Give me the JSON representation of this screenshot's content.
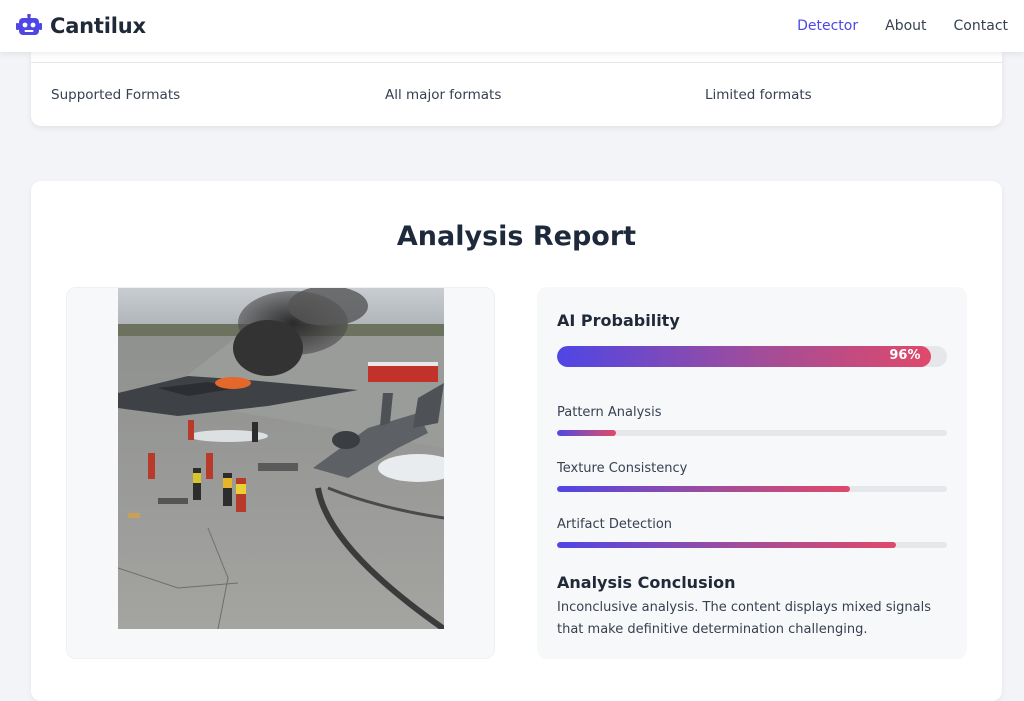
{
  "header": {
    "brand": "Cantilux",
    "brand_icon": "robot-icon",
    "nav": [
      {
        "label": "Detector",
        "active": true
      },
      {
        "label": "About",
        "active": false
      },
      {
        "label": "Contact",
        "active": false
      }
    ],
    "accent_color": "#4f46e5"
  },
  "formats": {
    "label": "Supported Formats",
    "col1": "All major formats",
    "col2": "Limited formats"
  },
  "report": {
    "title": "Analysis Report",
    "ai_probability": {
      "label": "AI Probability",
      "value_text": "96%",
      "value": 0.96
    },
    "metrics": [
      {
        "label": "Pattern Analysis",
        "value": 0.15
      },
      {
        "label": "Texture Consistency",
        "value": 0.75
      },
      {
        "label": "Artifact Detection",
        "value": 0.87
      }
    ],
    "conclusion": {
      "title": "Analysis Conclusion",
      "text": "Inconclusive analysis. The content displays mixed signals that make definitive determination challenging."
    },
    "gradient": [
      "#4f46e5",
      "#e0496a"
    ]
  }
}
